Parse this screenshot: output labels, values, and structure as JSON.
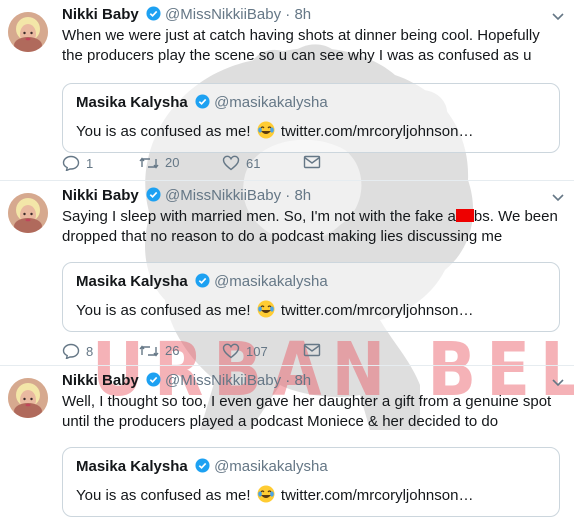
{
  "colors": {
    "accent": "#1da1f2",
    "muted": "#657786",
    "border": "#e6ecf0",
    "watermark": "#e85460",
    "censor": "#ee0000"
  },
  "watermark": {
    "text": "URBAN BELLE"
  },
  "tweets": [
    {
      "name": "Nikki Baby",
      "handle": "@MissNikkiiBaby",
      "dot": "·",
      "time": "8h",
      "text": "When we were just at catch having shots at dinner being cool. Hopefully the producers play the scene so u can see why I was as confused as u",
      "quote": {
        "name": "Masika Kalysha",
        "handle": "@masikakalysha",
        "text_before": "You is as confused as me!",
        "link": "twitter.com/mrcoryljohnson…"
      },
      "replies": "1",
      "retweets": "20",
      "likes": "61"
    },
    {
      "name": "Nikki Baby",
      "handle": "@MissNikkiiBaby",
      "dot": "·",
      "time": "8h",
      "text_a": "Saying I sleep with married men. So, I'm not with the fake a",
      "text_b": "bs. We been dropped that no reason to do a podcast making lies discussing me",
      "quote": {
        "name": "Masika Kalysha",
        "handle": "@masikakalysha",
        "text_before": "You is as confused as me!",
        "link": "twitter.com/mrcoryljohnson…"
      },
      "replies": "8",
      "retweets": "26",
      "likes": "107"
    },
    {
      "name": "Nikki Baby",
      "handle": "@MissNikkiiBaby",
      "dot": "·",
      "time": "8h",
      "text": "Well, I thought so too, I even gave her daughter a gift from a genuine spot until the producers played a podcast Moniece & her decided to do",
      "quote": {
        "name": "Masika Kalysha",
        "handle": "@masikakalysha",
        "text_before": "You is as confused as me!",
        "link": "twitter.com/mrcoryljohnson…"
      }
    }
  ]
}
